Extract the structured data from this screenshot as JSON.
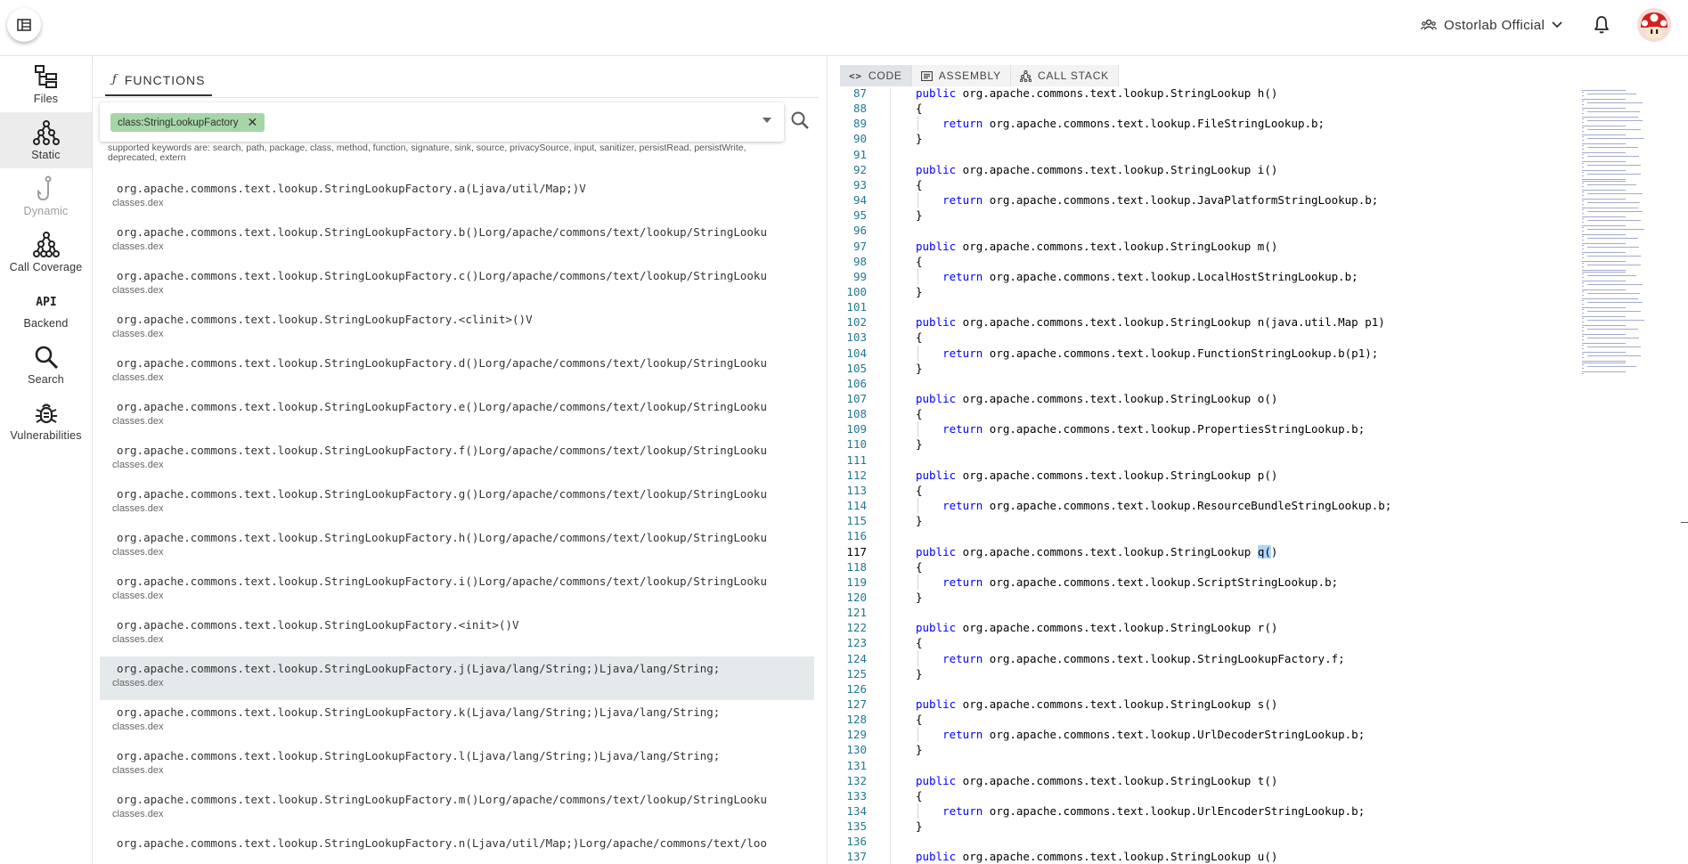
{
  "topbar": {
    "menu_icon": "dashboard-icon",
    "org_name": "Ostorlab Official",
    "org_icon": "group-icon",
    "bell_icon": "bell-icon",
    "avatar_icon": "mushroom-avatar"
  },
  "sidebar": {
    "items": [
      {
        "label": "Files",
        "icon": "files-icon",
        "state": "normal"
      },
      {
        "label": "Static",
        "icon": "static-graph-icon",
        "state": "active"
      },
      {
        "label": "Dynamic",
        "icon": "hook-icon",
        "state": "disabled"
      },
      {
        "label": "Call Coverage",
        "icon": "tree-icon",
        "state": "normal"
      },
      {
        "label": "Backend",
        "icon": "api-icon",
        "state": "normal"
      },
      {
        "label": "Search",
        "icon": "search-icon",
        "state": "normal"
      },
      {
        "label": "Vulnerabilities",
        "icon": "bug-icon",
        "state": "normal"
      }
    ]
  },
  "functions": {
    "tab_label": "FUNCTIONS",
    "tab_icon": "function-icon",
    "chip_label": "class:StringLookupFactory",
    "keywords_text": "supported keywords are: search, path, package, class, method, function, signature, sink, source, privacySource, input, sanitizer, persistRead, persistWrite, deprecated, extern",
    "items": [
      {
        "name": "org.apache.commons.text.lookup.StringLookupFactory.a(Ljava/util/Map;)V",
        "file": "classes.dex"
      },
      {
        "name": "org.apache.commons.text.lookup.StringLookupFactory.b()Lorg/apache/commons/text/lookup/StringLookup;",
        "file": "classes.dex"
      },
      {
        "name": "org.apache.commons.text.lookup.StringLookupFactory.c()Lorg/apache/commons/text/lookup/StringLookup;",
        "file": "classes.dex"
      },
      {
        "name": "org.apache.commons.text.lookup.StringLookupFactory.<clinit>()V",
        "file": "classes.dex"
      },
      {
        "name": "org.apache.commons.text.lookup.StringLookupFactory.d()Lorg/apache/commons/text/lookup/StringLookup;",
        "file": "classes.dex"
      },
      {
        "name": "org.apache.commons.text.lookup.StringLookupFactory.e()Lorg/apache/commons/text/lookup/StringLookup;",
        "file": "classes.dex"
      },
      {
        "name": "org.apache.commons.text.lookup.StringLookupFactory.f()Lorg/apache/commons/text/lookup/StringLookup;",
        "file": "classes.dex"
      },
      {
        "name": "org.apache.commons.text.lookup.StringLookupFactory.g()Lorg/apache/commons/text/lookup/StringLookup;",
        "file": "classes.dex"
      },
      {
        "name": "org.apache.commons.text.lookup.StringLookupFactory.h()Lorg/apache/commons/text/lookup/StringLookup;",
        "file": "classes.dex"
      },
      {
        "name": "org.apache.commons.text.lookup.StringLookupFactory.i()Lorg/apache/commons/text/lookup/StringLookup;",
        "file": "classes.dex"
      },
      {
        "name": "org.apache.commons.text.lookup.StringLookupFactory.<init>()V",
        "file": "classes.dex"
      },
      {
        "name": "org.apache.commons.text.lookup.StringLookupFactory.j(Ljava/lang/String;)Ljava/lang/String;",
        "file": "classes.dex",
        "selected": true
      },
      {
        "name": "org.apache.commons.text.lookup.StringLookupFactory.k(Ljava/lang/String;)Ljava/lang/String;",
        "file": "classes.dex"
      },
      {
        "name": "org.apache.commons.text.lookup.StringLookupFactory.l(Ljava/lang/String;)Ljava/lang/String;",
        "file": "classes.dex"
      },
      {
        "name": "org.apache.commons.text.lookup.StringLookupFactory.m()Lorg/apache/commons/text/lookup/StringLookup;",
        "file": "classes.dex"
      },
      {
        "name": "org.apache.commons.text.lookup.StringLookupFactory.n(Ljava/util/Map;)Lorg/apache/commons/text/lookup/StringLookup;",
        "file": ""
      }
    ]
  },
  "code": {
    "tabs": [
      {
        "label": "CODE",
        "icon": "code-icon",
        "active": true
      },
      {
        "label": "ASSEMBLY",
        "icon": "assembly-icon",
        "active": false
      },
      {
        "label": "CALL STACK",
        "icon": "callstack-icon",
        "active": false
      }
    ],
    "current_line": 117,
    "highlight": {
      "line": 117,
      "text": "q("
    },
    "lines": [
      {
        "n": 87,
        "text": "public org.apache.commons.text.lookup.StringLookup h()"
      },
      {
        "n": 88,
        "text": "{"
      },
      {
        "n": 89,
        "text": "    return org.apache.commons.text.lookup.FileStringLookup.b;"
      },
      {
        "n": 90,
        "text": "}"
      },
      {
        "n": 91,
        "text": ""
      },
      {
        "n": 92,
        "text": "public org.apache.commons.text.lookup.StringLookup i()"
      },
      {
        "n": 93,
        "text": "{"
      },
      {
        "n": 94,
        "text": "    return org.apache.commons.text.lookup.JavaPlatformStringLookup.b;"
      },
      {
        "n": 95,
        "text": "}"
      },
      {
        "n": 96,
        "text": ""
      },
      {
        "n": 97,
        "text": "public org.apache.commons.text.lookup.StringLookup m()"
      },
      {
        "n": 98,
        "text": "{"
      },
      {
        "n": 99,
        "text": "    return org.apache.commons.text.lookup.LocalHostStringLookup.b;"
      },
      {
        "n": 100,
        "text": "}"
      },
      {
        "n": 101,
        "text": ""
      },
      {
        "n": 102,
        "text": "public org.apache.commons.text.lookup.StringLookup n(java.util.Map p1)"
      },
      {
        "n": 103,
        "text": "{"
      },
      {
        "n": 104,
        "text": "    return org.apache.commons.text.lookup.FunctionStringLookup.b(p1);"
      },
      {
        "n": 105,
        "text": "}"
      },
      {
        "n": 106,
        "text": ""
      },
      {
        "n": 107,
        "text": "public org.apache.commons.text.lookup.StringLookup o()"
      },
      {
        "n": 108,
        "text": "{"
      },
      {
        "n": 109,
        "text": "    return org.apache.commons.text.lookup.PropertiesStringLookup.b;"
      },
      {
        "n": 110,
        "text": "}"
      },
      {
        "n": 111,
        "text": ""
      },
      {
        "n": 112,
        "text": "public org.apache.commons.text.lookup.StringLookup p()"
      },
      {
        "n": 113,
        "text": "{"
      },
      {
        "n": 114,
        "text": "    return org.apache.commons.text.lookup.ResourceBundleStringLookup.b;"
      },
      {
        "n": 115,
        "text": "}"
      },
      {
        "n": 116,
        "text": ""
      },
      {
        "n": 117,
        "text": "public org.apache.commons.text.lookup.StringLookup q()"
      },
      {
        "n": 118,
        "text": "{"
      },
      {
        "n": 119,
        "text": "    return org.apache.commons.text.lookup.ScriptStringLookup.b;"
      },
      {
        "n": 120,
        "text": "}"
      },
      {
        "n": 121,
        "text": ""
      },
      {
        "n": 122,
        "text": "public org.apache.commons.text.lookup.StringLookup r()"
      },
      {
        "n": 123,
        "text": "{"
      },
      {
        "n": 124,
        "text": "    return org.apache.commons.text.lookup.StringLookupFactory.f;"
      },
      {
        "n": 125,
        "text": "}"
      },
      {
        "n": 126,
        "text": ""
      },
      {
        "n": 127,
        "text": "public org.apache.commons.text.lookup.StringLookup s()"
      },
      {
        "n": 128,
        "text": "{"
      },
      {
        "n": 129,
        "text": "    return org.apache.commons.text.lookup.UrlDecoderStringLookup.b;"
      },
      {
        "n": 130,
        "text": "}"
      },
      {
        "n": 131,
        "text": ""
      },
      {
        "n": 132,
        "text": "public org.apache.commons.text.lookup.StringLookup t()"
      },
      {
        "n": 133,
        "text": "{"
      },
      {
        "n": 134,
        "text": "    return org.apache.commons.text.lookup.UrlEncoderStringLookup.b;"
      },
      {
        "n": 135,
        "text": "}"
      },
      {
        "n": 136,
        "text": ""
      },
      {
        "n": 137,
        "text": "public org.apache.commons.text.lookup.StringLookup u()"
      }
    ]
  },
  "colors": {
    "accent_chip": "#a5d6a7",
    "keyword": "#0000ff",
    "line_number": "#237893",
    "selection": "#add6ff",
    "sidebar_active": "#ececec",
    "list_selected": "#e4e9ec"
  }
}
